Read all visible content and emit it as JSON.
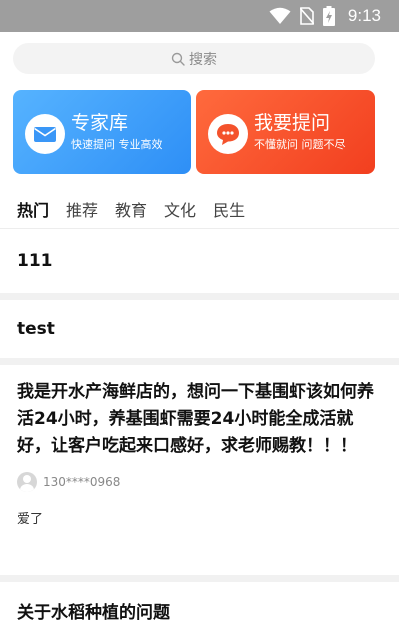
{
  "status_bar": {
    "time": "9:13",
    "icons": [
      "wifi-icon",
      "no-sim-icon",
      "battery-charging-icon"
    ]
  },
  "search": {
    "label": "搜索",
    "icon": "search-icon"
  },
  "cards": {
    "expert": {
      "title": "专家库",
      "subtitle": "快速提问  专业高效",
      "icon": "mail-icon",
      "color": "#3b9cfb"
    },
    "ask": {
      "title": "我要提问",
      "subtitle": "不懂就问  问题不尽",
      "icon": "chat-icon",
      "color": "#f7542b"
    }
  },
  "tabs": [
    {
      "label": "热门",
      "active": true
    },
    {
      "label": "推荐",
      "active": false
    },
    {
      "label": "教育",
      "active": false
    },
    {
      "label": "文化",
      "active": false
    },
    {
      "label": "民生",
      "active": false
    }
  ],
  "posts": [
    {
      "title": "111"
    },
    {
      "title": "test"
    },
    {
      "title": "我是开水产海鲜店的，想问一下基围虾该如何养活24小时，养基围虾需要24小时能全成活就好，让客户吃起来口感好，求老师赐教！！！",
      "author": "130****0968",
      "answer": "爱了"
    },
    {
      "title": "关于水稻种植的问题"
    }
  ]
}
